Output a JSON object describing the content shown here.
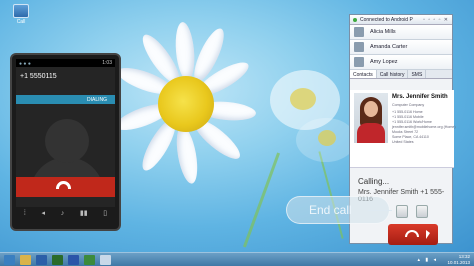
{
  "desktop": {
    "icon_label": "Call"
  },
  "phone": {
    "status_time": "1:03",
    "number": "+1 5550115",
    "state": "DIALING"
  },
  "panel": {
    "title": "Connected to Android P",
    "favorites": [
      "Alicia Mills",
      "Amanda Carter",
      "Amy Lopez"
    ],
    "tabs": [
      "Contacts",
      "Call history",
      "SMS"
    ],
    "contact": {
      "name": "Mrs. Jennifer Smith",
      "company": "Computer Company",
      "lines": [
        "+1 555-0116 Home",
        "+1 555-0116 Mobile",
        "+1 555-0116 Work/Home",
        "jennifer.smith@mobilehome.org (Home)",
        "Mooks Street 72",
        "Some Place, CA 44110",
        "United States"
      ]
    },
    "calling_label": "Calling...",
    "calling_detail": "Mrs. Jennifer Smith +1 555-0116"
  },
  "callout": {
    "text": "End call"
  },
  "taskbar": {
    "time": "13:32",
    "date": "10.01.2013"
  },
  "colors": {
    "end_call": "#c0281b",
    "phone_bar": "#2a8db2",
    "taskbar": "#4f86b3"
  }
}
